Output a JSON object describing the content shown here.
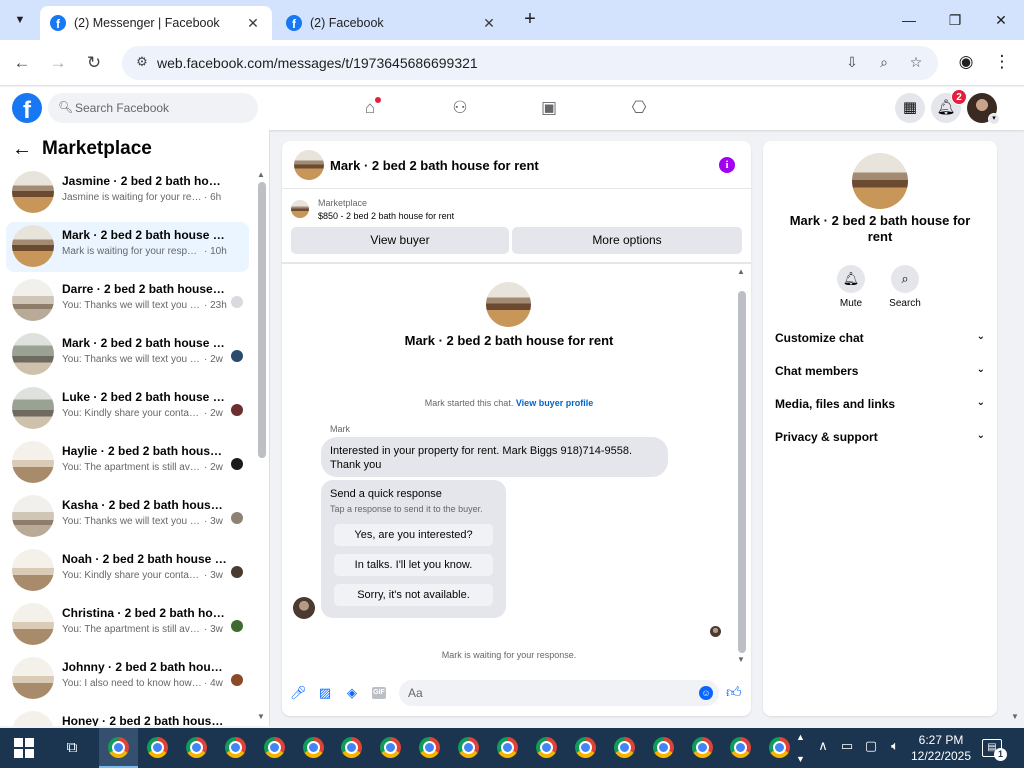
{
  "browser": {
    "tabs": [
      {
        "title": "(2) Messenger | Facebook",
        "active": true
      },
      {
        "title": "(2) Facebook",
        "active": false
      }
    ],
    "new_tab": "+",
    "url": "web.facebook.com/messages/t/1973645686699321",
    "window_controls": {
      "minimize": "—",
      "maximize": "❐",
      "close": "✕"
    }
  },
  "fb_header": {
    "logo": "f",
    "search_placeholder": "Search Facebook",
    "nav_icons": [
      "home-icon",
      "friends-icon",
      "watch-icon",
      "gaming-icon"
    ],
    "notification_badge": "2"
  },
  "sidebar": {
    "title": "Marketplace",
    "conversations": [
      {
        "title": "Jasmine · 2 bed 2 bath house fo...",
        "preview": "Jasmine is waiting for your respon...",
        "time": "· 6h",
        "selected": false,
        "read_avatar": false
      },
      {
        "title": "Mark · 2 bed 2 bath house for r...",
        "preview": "Mark is waiting for your response.",
        "time": "· 10h",
        "selected": true,
        "read_avatar": false
      },
      {
        "title": "Darre · 2 bed 2 bath house fo...",
        "preview": "You: Thanks we will text you s...",
        "time": "· 23h",
        "selected": false,
        "read_avatar": true
      },
      {
        "title": "Mark · 2 bed 2 bath house fo...",
        "preview": "You: Thanks we will text you so...",
        "time": "· 2w",
        "selected": false,
        "read_avatar": true
      },
      {
        "title": "Luke · 2 bed 2 bath house for...",
        "preview": "You: Kindly share your contact ...",
        "time": "· 2w",
        "selected": false,
        "read_avatar": true
      },
      {
        "title": "Haylie · 2 bed 2 bath house f...",
        "preview": "You: The apartment is still avail...",
        "time": "· 2w",
        "selected": false,
        "read_avatar": true
      },
      {
        "title": "Kasha · 2 bed 2 bath house f...",
        "preview": "You: Thanks we will text you so...",
        "time": "· 3w",
        "selected": false,
        "read_avatar": true
      },
      {
        "title": "Noah · 2 bed 2 bath house fo...",
        "preview": "You: Kindly share your contact ...",
        "time": "· 3w",
        "selected": false,
        "read_avatar": true
      },
      {
        "title": "Christina · 2 bed 2 bath hous...",
        "preview": "You: The apartment is still avail...",
        "time": "· 3w",
        "selected": false,
        "read_avatar": true
      },
      {
        "title": "Johnny · 2 bed 2 bath house ...",
        "preview": "You: I also need to know how ...",
        "time": "· 4w",
        "selected": false,
        "read_avatar": true
      },
      {
        "title": "Honey · 2 bed 2 bath house for ...",
        "preview": "",
        "time": "",
        "selected": false,
        "read_avatar": false
      }
    ]
  },
  "conversation": {
    "header_title": "Mark · 2 bed 2 bath house for rent",
    "listing": {
      "label": "Marketplace",
      "price_title": "$850 - 2 bed 2 bath house for rent",
      "view_buyer": "View buyer",
      "more_options": "More options"
    },
    "hero_title": "Mark · 2 bed 2 bath house for rent",
    "started_text": "Mark started this chat.",
    "view_profile_link": "View buyer profile",
    "sender_name": "Mark",
    "message": "Interested in your property for rent. Mark Biggs 918)714-9558. Thank you",
    "quick_response": {
      "title": "Send a quick response",
      "subtitle": "Tap a response to send it to the buyer.",
      "options": [
        "Yes, are you interested?",
        "In talks. I'll let you know.",
        "Sorry, it's not available."
      ]
    },
    "waiting_text": "Mark is waiting for your response.",
    "composer_placeholder": "Aa"
  },
  "details": {
    "title": "Mark · 2 bed 2 bath house for rent",
    "actions": [
      {
        "label": "Mute",
        "icon": "bell-icon"
      },
      {
        "label": "Search",
        "icon": "search-icon"
      }
    ],
    "sections": [
      "Customize chat",
      "Chat members",
      "Media, files and links",
      "Privacy & support"
    ]
  },
  "taskbar": {
    "time": "6:27 PM",
    "date": "12/22/2025",
    "notification_count": "1",
    "chrome_windows": 18
  },
  "colors": {
    "brand": "#1877f2",
    "messenger_blue": "#0866ff",
    "info_purple": "#a100f2",
    "badge_red": "#e41e3f",
    "selected_row": "#ebf5ff",
    "taskbar": "#1b3450"
  }
}
